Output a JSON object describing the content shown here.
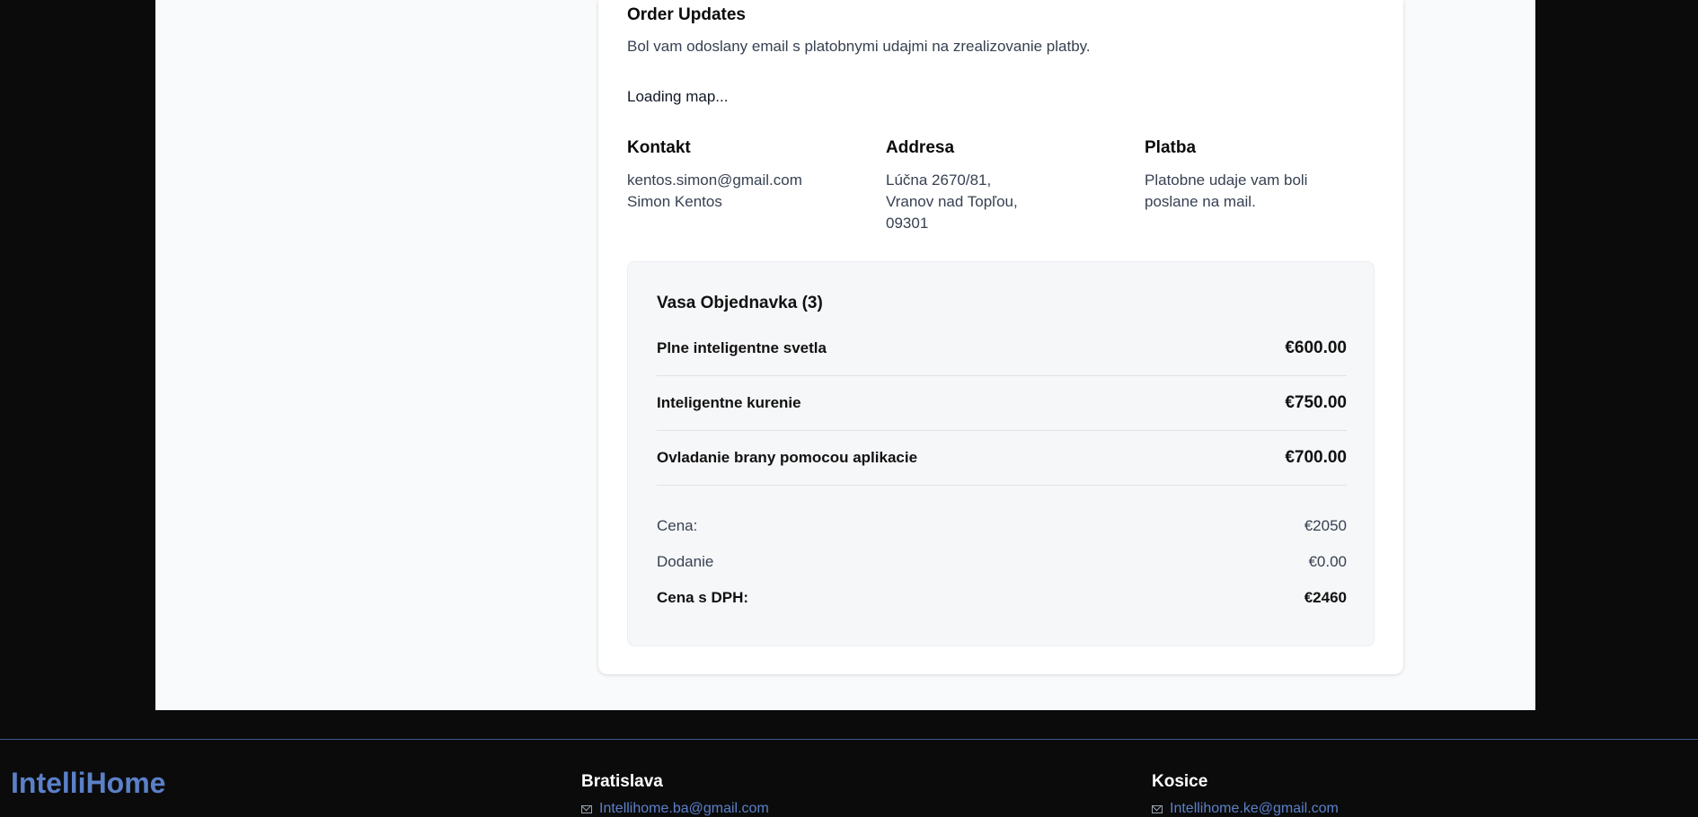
{
  "order_updates": {
    "title": "Order Updates",
    "message": "Bol vam odoslany email s platobnymi udajmi na zrealizovanie platby."
  },
  "map": {
    "loading_text": "Loading map..."
  },
  "contact": {
    "title": "Kontakt",
    "email": "kentos.simon@gmail.com",
    "name": "Simon Kentos"
  },
  "address": {
    "title": "Addresa",
    "line1": "Lúčna 2670/81,",
    "line2": "Vranov nad Topľou,",
    "line3": "09301"
  },
  "payment": {
    "title": "Platba",
    "line1": "Platobne udaje vam boli",
    "line2": "poslane na mail."
  },
  "order": {
    "title": "Vasa Objednavka (3)",
    "items": [
      {
        "name": "Plne inteligentne svetla",
        "price": "€600.00"
      },
      {
        "name": "Inteligentne kurenie",
        "price": "€750.00"
      },
      {
        "name": "Ovladanie brany pomocou aplikacie",
        "price": "€700.00"
      }
    ],
    "subtotal_label": "Cena:",
    "subtotal_value": "€2050",
    "shipping_label": "Dodanie",
    "shipping_value": "€0.00",
    "total_label": "Cena s DPH:",
    "total_value": "€2460"
  },
  "footer": {
    "brand": "IntelliHome",
    "offices": [
      {
        "city": "Bratislava",
        "email": "Intellihome.ba@gmail.com"
      },
      {
        "city": "Kosice",
        "email": "Intellihome.ke@gmail.com"
      }
    ]
  },
  "colors": {
    "brand_blue": "#5b80c7",
    "background_dark": "#0b0b0c",
    "card_white": "#ffffff"
  }
}
